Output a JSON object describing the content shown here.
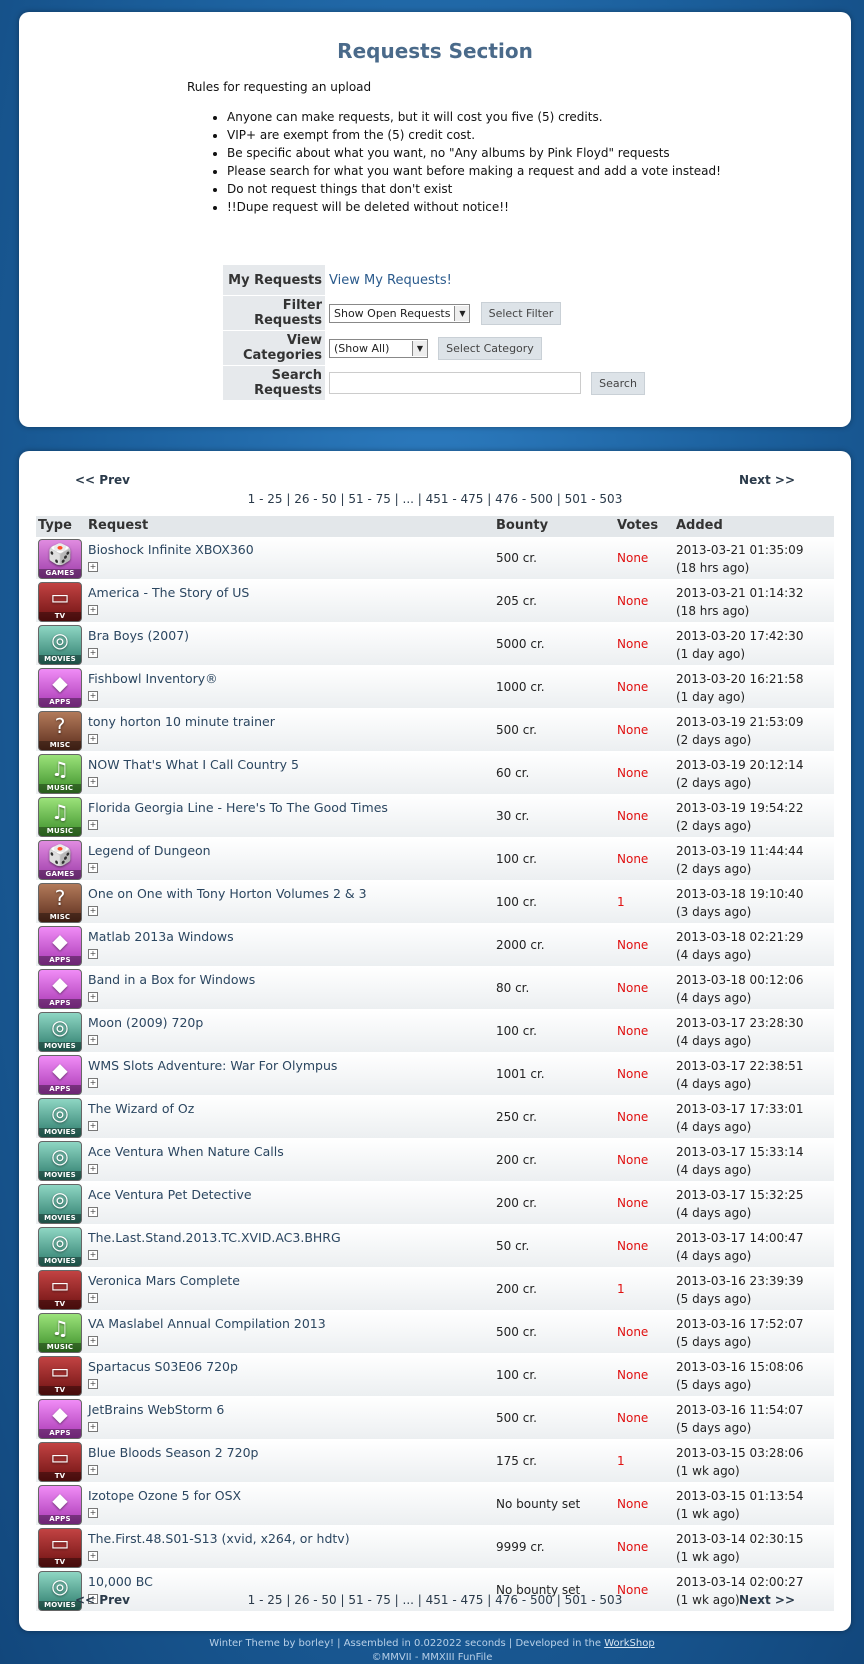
{
  "title": "Requests Section",
  "rules": {
    "heading": "Rules for requesting an upload",
    "items": [
      "Anyone can make requests, but it will cost you five (5) credits.",
      "VIP+ are exempt from the (5) credit cost.",
      "Be specific about what you want, no \"Any albums by Pink Floyd\" requests",
      "Please search for what you want before making a request and add a vote instead!",
      "Do not request things that don't exist",
      "!!Dupe request will be deleted without notice!!"
    ]
  },
  "form": {
    "my_requests_label": "My Requests",
    "my_requests_link": "View My Requests!",
    "filter_label": "Filter Requests",
    "filter_value": "Show Open Requests",
    "filter_button": "Select Filter",
    "categories_label": "View Categories",
    "categories_value": "(Show All)",
    "categories_button": "Select Category",
    "search_label": "Search Requests",
    "search_value": "",
    "search_button": "Search"
  },
  "pager": {
    "prev": "<< Prev",
    "next": "Next >>",
    "pages": [
      "1 - 25",
      "26 - 50",
      "51 - 75",
      "...",
      "451 - 475",
      "476 - 500",
      "501 - 503"
    ]
  },
  "columns": {
    "type": "Type",
    "request": "Request",
    "bounty": "Bounty",
    "votes": "Votes",
    "added": "Added"
  },
  "rows": [
    {
      "type": "GAMES",
      "icon": "games-icon",
      "name": "Bioshock Infinite XBOX360",
      "bounty": "500 cr.",
      "votes": "None",
      "date": "2013-03-21 01:35:09",
      "ago": "(18 hrs ago)"
    },
    {
      "type": "TV",
      "icon": "tv-icon",
      "name": "America - The Story of US",
      "bounty": "205 cr.",
      "votes": "None",
      "date": "2013-03-21 01:14:32",
      "ago": "(18 hrs ago)"
    },
    {
      "type": "MOVIES",
      "icon": "movies-icon",
      "name": "Bra Boys (2007)",
      "bounty": "5000 cr.",
      "votes": "None",
      "date": "2013-03-20 17:42:30",
      "ago": "(1 day ago)"
    },
    {
      "type": "APPS",
      "icon": "apps-icon",
      "name": "Fishbowl Inventory®",
      "bounty": "1000 cr.",
      "votes": "None",
      "date": "2013-03-20 16:21:58",
      "ago": "(1 day ago)"
    },
    {
      "type": "MISC",
      "icon": "misc-icon",
      "name": "tony horton 10 minute trainer",
      "bounty": "500 cr.",
      "votes": "None",
      "date": "2013-03-19 21:53:09",
      "ago": "(2 days ago)"
    },
    {
      "type": "MUSIC",
      "icon": "music-icon",
      "name": "NOW That's What I Call Country 5",
      "bounty": "60 cr.",
      "votes": "None",
      "date": "2013-03-19 20:12:14",
      "ago": "(2 days ago)"
    },
    {
      "type": "MUSIC",
      "icon": "music-icon",
      "name": "Florida Georgia Line - Here's To The Good Times",
      "bounty": "30 cr.",
      "votes": "None",
      "date": "2013-03-19 19:54:22",
      "ago": "(2 days ago)"
    },
    {
      "type": "GAMES",
      "icon": "games-icon",
      "name": "Legend of Dungeon",
      "bounty": "100 cr.",
      "votes": "None",
      "date": "2013-03-19 11:44:44",
      "ago": "(2 days ago)"
    },
    {
      "type": "MISC",
      "icon": "misc-icon",
      "name": "One on One with Tony Horton Volumes 2 & 3",
      "bounty": "100 cr.",
      "votes": "1",
      "date": "2013-03-18 19:10:40",
      "ago": "(3 days ago)"
    },
    {
      "type": "APPS",
      "icon": "apps-icon",
      "name": "Matlab 2013a Windows",
      "bounty": "2000 cr.",
      "votes": "None",
      "date": "2013-03-18 02:21:29",
      "ago": "(4 days ago)"
    },
    {
      "type": "APPS",
      "icon": "apps-icon",
      "name": "Band in a Box for Windows",
      "bounty": "80 cr.",
      "votes": "None",
      "date": "2013-03-18 00:12:06",
      "ago": "(4 days ago)"
    },
    {
      "type": "MOVIES",
      "icon": "movies-icon",
      "name": "Moon (2009) 720p",
      "bounty": "100 cr.",
      "votes": "None",
      "date": "2013-03-17 23:28:30",
      "ago": "(4 days ago)"
    },
    {
      "type": "APPS",
      "icon": "apps-icon",
      "name": "WMS Slots Adventure: War For Olympus",
      "bounty": "1001 cr.",
      "votes": "None",
      "date": "2013-03-17 22:38:51",
      "ago": "(4 days ago)"
    },
    {
      "type": "MOVIES",
      "icon": "movies-icon",
      "name": "The Wizard of Oz",
      "bounty": "250 cr.",
      "votes": "None",
      "date": "2013-03-17 17:33:01",
      "ago": "(4 days ago)"
    },
    {
      "type": "MOVIES",
      "icon": "movies-icon",
      "name": "Ace Ventura When Nature Calls",
      "bounty": "200 cr.",
      "votes": "None",
      "date": "2013-03-17 15:33:14",
      "ago": "(4 days ago)"
    },
    {
      "type": "MOVIES",
      "icon": "movies-icon",
      "name": "Ace Ventura Pet Detective",
      "bounty": "200 cr.",
      "votes": "None",
      "date": "2013-03-17 15:32:25",
      "ago": "(4 days ago)"
    },
    {
      "type": "MOVIES",
      "icon": "movies-icon",
      "name": "The.Last.Stand.2013.TC.XVID.AC3.BHRG",
      "bounty": "50 cr.",
      "votes": "None",
      "date": "2013-03-17 14:00:47",
      "ago": "(4 days ago)"
    },
    {
      "type": "TV",
      "icon": "tv-icon",
      "name": "Veronica Mars Complete",
      "bounty": "200 cr.",
      "votes": "1",
      "date": "2013-03-16 23:39:39",
      "ago": "(5 days ago)"
    },
    {
      "type": "MUSIC",
      "icon": "music-icon",
      "name": "VA Maslabel Annual Compilation 2013",
      "bounty": "500 cr.",
      "votes": "None",
      "date": "2013-03-16 17:52:07",
      "ago": "(5 days ago)"
    },
    {
      "type": "TV",
      "icon": "tv-icon",
      "name": "Spartacus S03E06 720p",
      "bounty": "100 cr.",
      "votes": "None",
      "date": "2013-03-16 15:08:06",
      "ago": "(5 days ago)"
    },
    {
      "type": "APPS",
      "icon": "apps-icon",
      "name": "JetBrains WebStorm 6",
      "bounty": "500 cr.",
      "votes": "None",
      "date": "2013-03-16 11:54:07",
      "ago": "(5 days ago)"
    },
    {
      "type": "TV",
      "icon": "tv-icon",
      "name": "Blue Bloods Season 2 720p",
      "bounty": "175 cr.",
      "votes": "1",
      "date": "2013-03-15 03:28:06",
      "ago": "(1 wk ago)"
    },
    {
      "type": "APPS",
      "icon": "apps-icon",
      "name": "Izotope Ozone 5 for OSX",
      "bounty": "No bounty set",
      "votes": "None",
      "date": "2013-03-15 01:13:54",
      "ago": "(1 wk ago)"
    },
    {
      "type": "TV",
      "icon": "tv-icon",
      "name": "The.First.48.S01-S13 (xvid, x264, or hdtv)",
      "bounty": "9999 cr.",
      "votes": "None",
      "date": "2013-03-14 02:30:15",
      "ago": "(1 wk ago)"
    },
    {
      "type": "MOVIES",
      "icon": "movies-icon",
      "name": "10,000 BC",
      "bounty": "No bounty set",
      "votes": "None",
      "date": "2013-03-14 02:00:27",
      "ago": "(1 wk ago)"
    }
  ],
  "footer": {
    "line1_a": "Winter Theme by borley! | Assembled in 0.022022 seconds | Developed in the ",
    "line1_link": "WorkShop",
    "line2": "©MMVII - MMXIII FunFile"
  },
  "colors": {
    "background": "#1a5d98",
    "votes_red": "#e01010",
    "header_gray": "#e3e7ea"
  }
}
